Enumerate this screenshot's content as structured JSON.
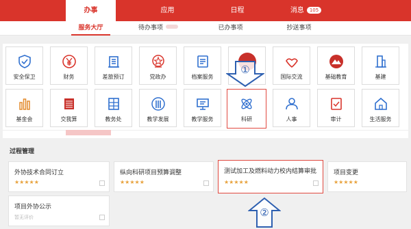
{
  "nav": {
    "tabs": [
      {
        "label": "办事"
      },
      {
        "label": "应用"
      },
      {
        "label": "日程"
      },
      {
        "label": "消息"
      }
    ],
    "message_badge": "105"
  },
  "subtabs": [
    {
      "label": "服务大厅"
    },
    {
      "label": "待办事项"
    },
    {
      "label": "已办事项"
    },
    {
      "label": "抄送事项"
    }
  ],
  "services": [
    {
      "label": "安全保卫",
      "icon": "shield-check-icon"
    },
    {
      "label": "财务",
      "icon": "yen-icon"
    },
    {
      "label": "差旅预订",
      "icon": "building-icon"
    },
    {
      "label": "党政办",
      "icon": "star-emblem-icon"
    },
    {
      "label": "档案服务",
      "icon": "archive-icon"
    },
    {
      "label": "",
      "icon": "hidden-icon"
    },
    {
      "label": "国际交流",
      "icon": "handshake-icon"
    },
    {
      "label": "基础教育",
      "icon": "mountain-icon"
    },
    {
      "label": "基建",
      "icon": "tower-icon"
    },
    {
      "label": "基金会",
      "icon": "bar-chart-icon"
    },
    {
      "label": "交我算",
      "icon": "server-icon"
    },
    {
      "label": "教务处",
      "icon": "grid-book-icon"
    },
    {
      "label": "教学发展",
      "icon": "pillars-icon"
    },
    {
      "label": "教学服务",
      "icon": "board-icon"
    },
    {
      "label": "科研",
      "icon": "atom-icon"
    },
    {
      "label": "人事",
      "icon": "person-icon"
    },
    {
      "label": "审计",
      "icon": "audit-icon"
    },
    {
      "label": "生活服务",
      "icon": "home-icon"
    }
  ],
  "annotations": {
    "step1": "①",
    "step2": "②"
  },
  "process": {
    "title": "过程管理",
    "cards": [
      {
        "title": "外协技术合同订立",
        "stars": "★★★★★"
      },
      {
        "title": "纵向科研项目预算调整",
        "stars": "★★★★★"
      },
      {
        "title": "测试加工及燃料动力校内结算审批",
        "stars": "★★★★★"
      },
      {
        "title": "项目变更",
        "stars": "★★★★★"
      },
      {
        "title": "项目外协公示",
        "sub": "暂无评价"
      }
    ]
  },
  "colors": {
    "brand": "#d9342b",
    "icon_blue": "#2f6fcf",
    "star": "#e8a23c",
    "arrow_blue": "#2d5fb0"
  }
}
